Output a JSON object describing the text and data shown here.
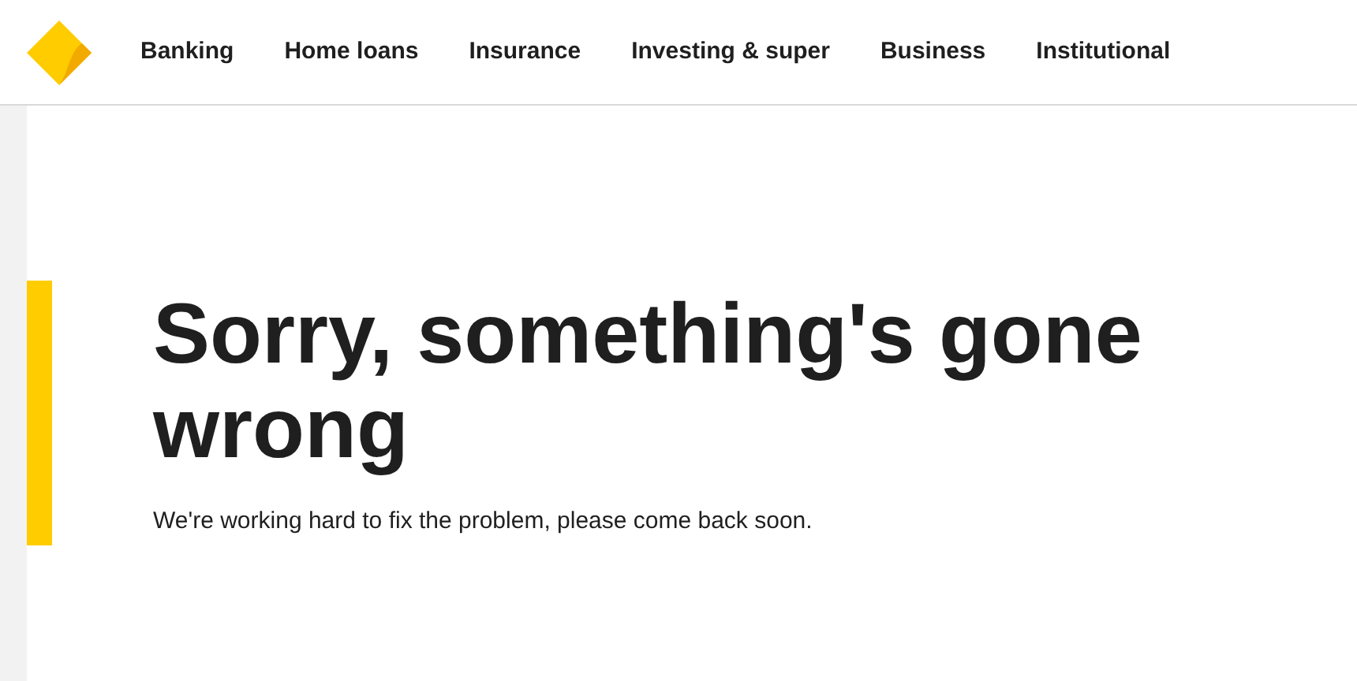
{
  "nav": {
    "items": [
      "Banking",
      "Home loans",
      "Insurance",
      "Investing & super",
      "Business",
      "Institutional"
    ]
  },
  "error": {
    "title": "Sorry, something's gone wrong",
    "message": "We're working hard to fix the problem, please come back soon."
  }
}
